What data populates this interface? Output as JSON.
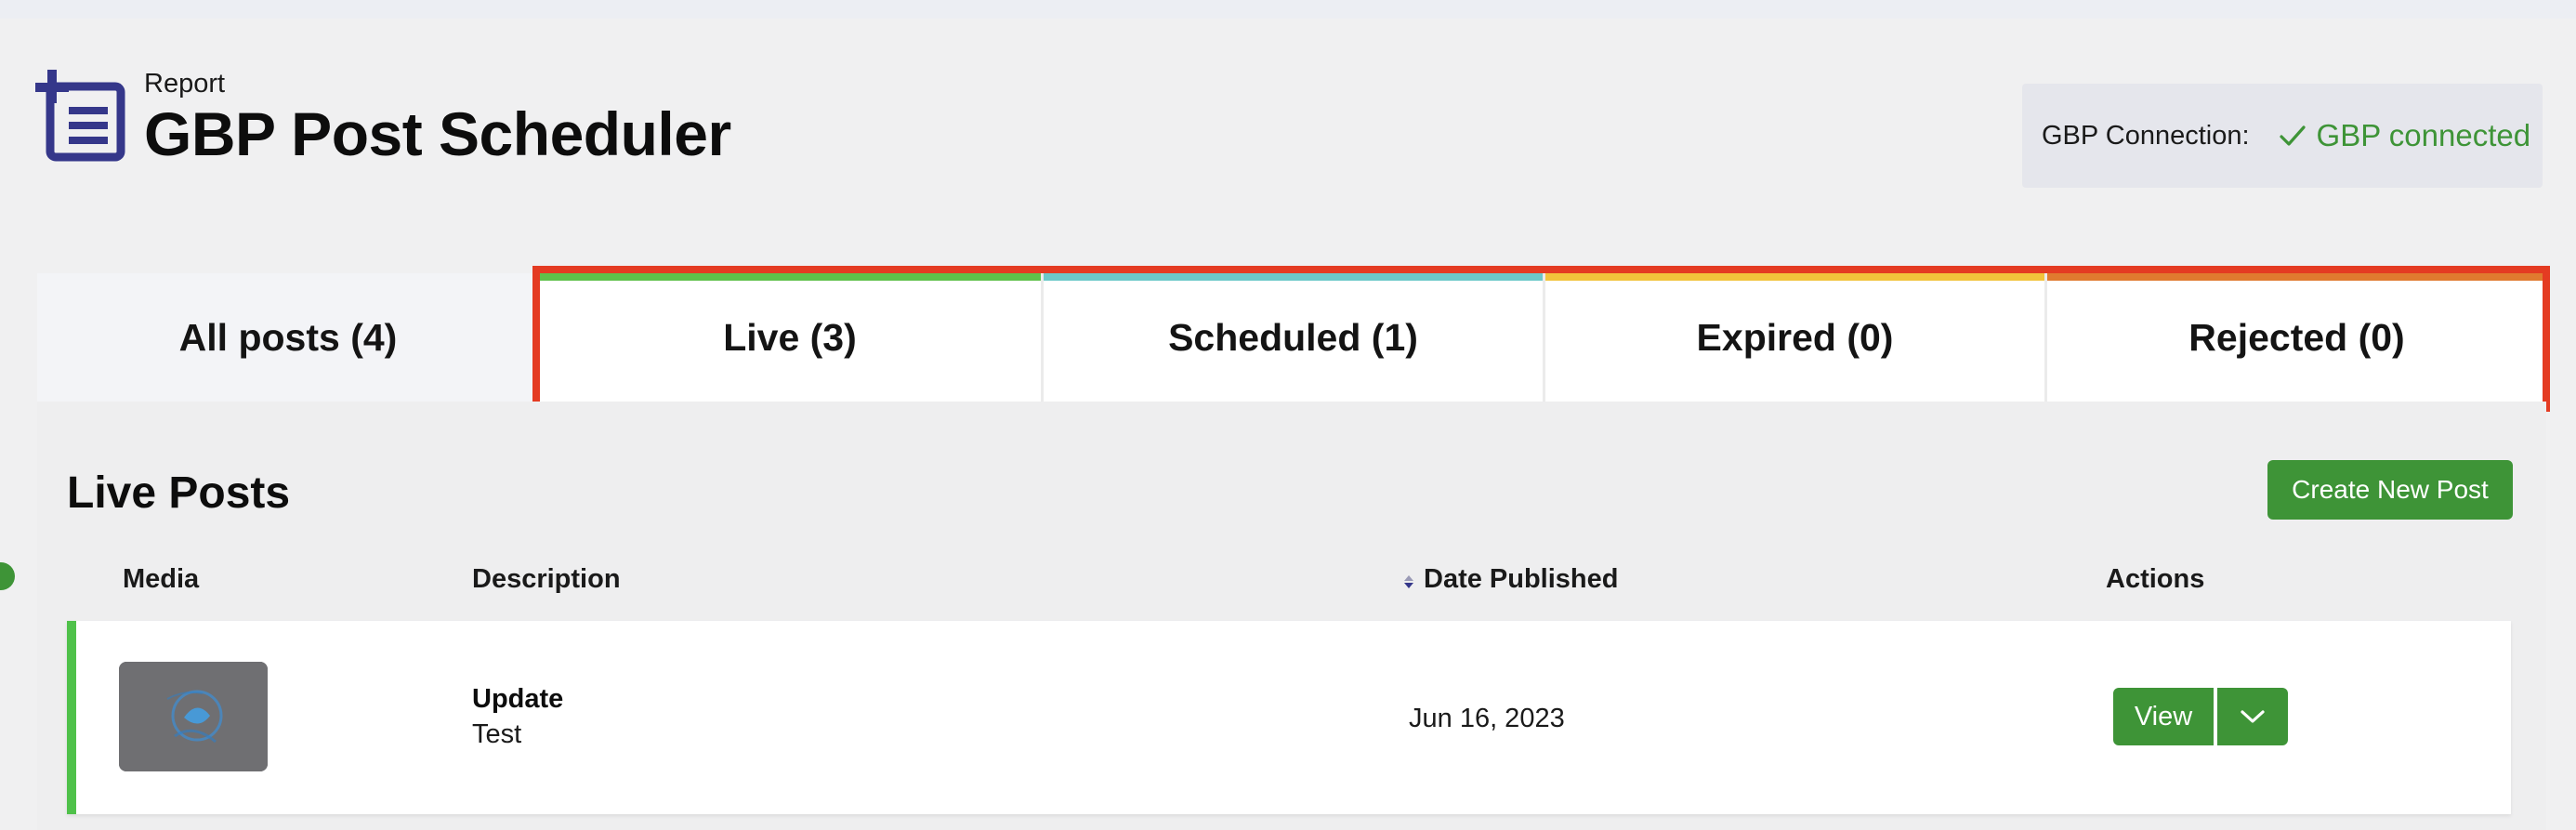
{
  "header": {
    "eyebrow": "Report",
    "title": "GBP Post Scheduler",
    "icon": "report-add-icon"
  },
  "connection": {
    "label": "GBP Connection:",
    "status": "GBP connected",
    "status_color": "#3e9437"
  },
  "tabs": [
    {
      "label": "All posts (4)",
      "bar_color": null
    },
    {
      "label": "Live (3)",
      "bar_color": "#5fc14a"
    },
    {
      "label": "Scheduled (1)",
      "bar_color": "#6cc8c8"
    },
    {
      "label": "Expired (0)",
      "bar_color": "#f2c33b"
    },
    {
      "label": "Rejected (0)",
      "bar_color": "#e07a2f"
    }
  ],
  "section": {
    "title": "Live Posts",
    "create_button": "Create New Post"
  },
  "table": {
    "columns": [
      "Media",
      "Description",
      "Date Published",
      "Actions"
    ],
    "rows": [
      {
        "type": "Update",
        "description": "Test",
        "date": "Jun 16, 2023",
        "view_label": "View"
      }
    ]
  },
  "colors": {
    "brand_green": "#3e9437",
    "live_green": "#4fc14a",
    "highlight_red": "#e43b22",
    "icon_navy": "#35378a"
  }
}
